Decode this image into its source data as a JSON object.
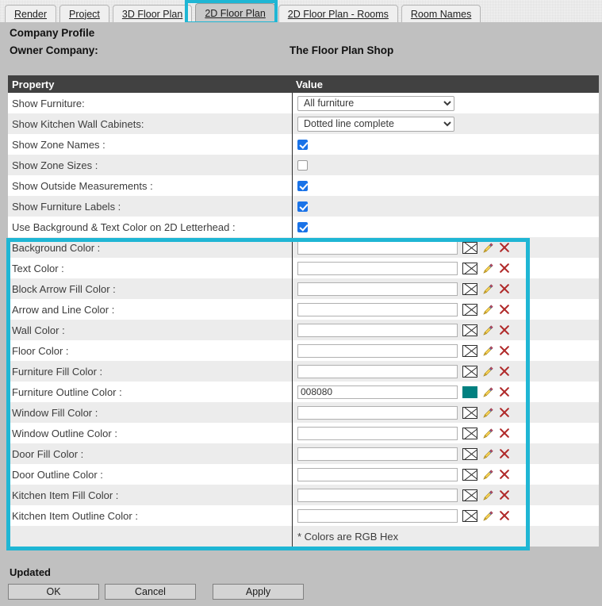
{
  "tabs": [
    {
      "label": "Render",
      "active": false
    },
    {
      "label": "Project",
      "active": false
    },
    {
      "label": "3D Floor Plan",
      "active": false
    },
    {
      "label": "2D Floor Plan",
      "active": true
    },
    {
      "label": "2D Floor Plan - Rooms",
      "active": false
    },
    {
      "label": "Room Names",
      "active": false
    }
  ],
  "header": {
    "profile_title": "Company Profile",
    "owner_label": "Owner Company:",
    "owner_value": "The Floor Plan Shop"
  },
  "table": {
    "col_property": "Property",
    "col_value": "Value",
    "rows": [
      {
        "label": "Show Furniture:",
        "type": "select",
        "value": "All furniture"
      },
      {
        "label": "Show Kitchen Wall Cabinets:",
        "type": "select",
        "value": "Dotted line complete"
      },
      {
        "label": "Show Zone Names :",
        "type": "checkbox",
        "checked": true
      },
      {
        "label": "Show Zone Sizes :",
        "type": "checkbox",
        "checked": false
      },
      {
        "label": "Show Outside Measurements :",
        "type": "checkbox",
        "checked": true
      },
      {
        "label": "Show Furniture Labels :",
        "type": "checkbox",
        "checked": true
      },
      {
        "label": "Use Background & Text Color on 2D Letterhead :",
        "type": "checkbox",
        "checked": true
      },
      {
        "label": "Background Color :",
        "type": "color",
        "value": "",
        "swatch": ""
      },
      {
        "label": "Text Color :",
        "type": "color",
        "value": "",
        "swatch": ""
      },
      {
        "label": "Block Arrow Fill Color :",
        "type": "color",
        "value": "",
        "swatch": ""
      },
      {
        "label": "Arrow and Line Color :",
        "type": "color",
        "value": "",
        "swatch": ""
      },
      {
        "label": "Wall Color :",
        "type": "color",
        "value": "",
        "swatch": ""
      },
      {
        "label": "Floor Color :",
        "type": "color",
        "value": "",
        "swatch": ""
      },
      {
        "label": "Furniture Fill Color :",
        "type": "color",
        "value": "",
        "swatch": ""
      },
      {
        "label": "Furniture Outline Color :",
        "type": "color",
        "value": "008080",
        "swatch": "#008080"
      },
      {
        "label": "Window Fill Color :",
        "type": "color",
        "value": "",
        "swatch": ""
      },
      {
        "label": "Window Outline Color :",
        "type": "color",
        "value": "",
        "swatch": ""
      },
      {
        "label": "Door Fill Color :",
        "type": "color",
        "value": "",
        "swatch": ""
      },
      {
        "label": "Door Outline Color :",
        "type": "color",
        "value": "",
        "swatch": ""
      },
      {
        "label": "Kitchen Item Fill Color :",
        "type": "color",
        "value": "",
        "swatch": ""
      },
      {
        "label": "Kitchen Item Outline Color :",
        "type": "color",
        "value": "",
        "swatch": ""
      },
      {
        "label": "",
        "type": "note",
        "value": "* Colors are RGB Hex"
      }
    ],
    "hex_placeholder": ""
  },
  "icons": {
    "swatch_empty": "empty-color-swatch-icon",
    "edit": "pencil-edit-icon",
    "clear": "red-x-clear-icon",
    "dropdown": "chevron-down-icon"
  },
  "footer": {
    "status": "Updated",
    "ok": "OK",
    "cancel": "Cancel",
    "apply": "Apply"
  },
  "colors": {
    "highlight": "#1fb6d4",
    "header_bar": "#414141",
    "panel": "#c0c0c0",
    "checkbox_on": "#1a73e8",
    "teal_swatch": "#008080"
  }
}
